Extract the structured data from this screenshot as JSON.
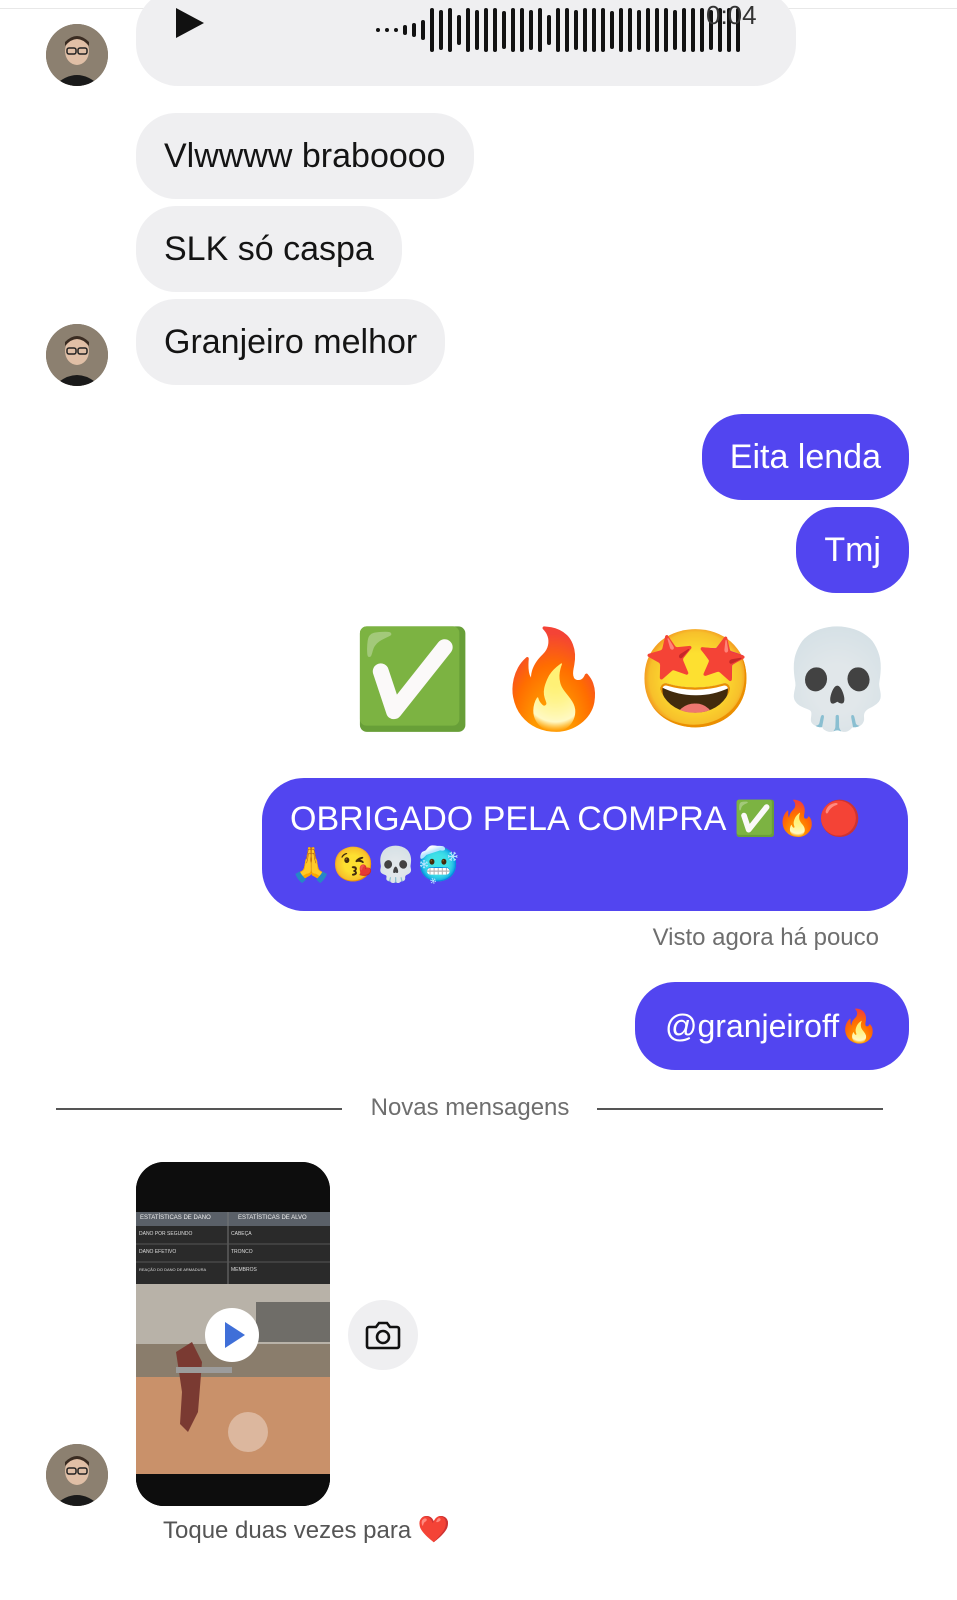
{
  "voice_message": {
    "duration": "0:04"
  },
  "incoming_messages": [
    "Vlwwww braboooo",
    "SLK só caspa",
    "Granjeiro melhor"
  ],
  "outgoing_messages": {
    "msg1": "Eita lenda",
    "msg2": "Tmj",
    "emoji_row": [
      "✅",
      "🔥",
      "🤩",
      "💀"
    ],
    "long_msg": "OBRIGADO PELA COMPRA ✅🔥🔴🙏😘💀🥶",
    "seen_status": "Visto agora há pouco",
    "mention_msg": "@granjeiroff🔥"
  },
  "divider": {
    "label": "Novas mensagens"
  },
  "video_message": {
    "hint_text": "Toque duas vezes para",
    "hint_emoji": "❤️",
    "header_left": "ESTATÍSTICAS DE DANO",
    "header_right": "ESTATÍSTICAS DE ALVO",
    "rows_left": [
      "DANO POR SEGUNDO",
      "DANO EFETIVO",
      "REAÇÃO DO DANO DE ARMADURA"
    ],
    "rows_right": [
      "CABEÇA",
      "TRONCO",
      "MEMBROS"
    ]
  },
  "colors": {
    "outgoing": "#5245f0",
    "incoming": "#efeff1"
  }
}
